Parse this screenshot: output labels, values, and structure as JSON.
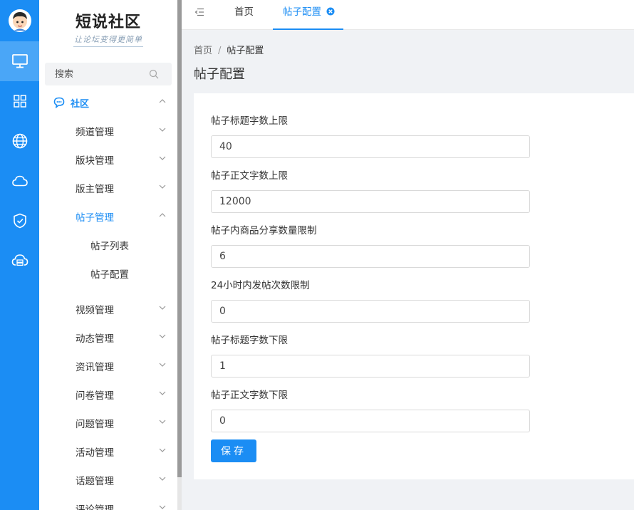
{
  "app": {
    "logo_title": "短说社区",
    "logo_subtitle": "让论坛变得更简单"
  },
  "rail": {
    "items": [
      {
        "icon": "monitor-icon",
        "active": true
      },
      {
        "icon": "grid-icon",
        "active": false
      },
      {
        "icon": "globe-icon",
        "active": false
      },
      {
        "icon": "cloud-icon",
        "active": false
      },
      {
        "icon": "shield-check-icon",
        "active": false
      },
      {
        "icon": "cloud-server-icon",
        "active": false
      }
    ]
  },
  "search": {
    "placeholder": "搜索"
  },
  "nav": {
    "group": {
      "label": "社区",
      "icon": "chat-icon"
    },
    "items": [
      {
        "label": "频道管理"
      },
      {
        "label": "版块管理"
      },
      {
        "label": "版主管理"
      },
      {
        "label": "帖子管理",
        "expanded": true
      },
      {
        "label": "视频管理"
      },
      {
        "label": "动态管理"
      },
      {
        "label": "资讯管理"
      },
      {
        "label": "问卷管理"
      },
      {
        "label": "问题管理"
      },
      {
        "label": "活动管理"
      },
      {
        "label": "话题管理"
      },
      {
        "label": "评论管理"
      }
    ],
    "sub_items": [
      {
        "label": "帖子列表"
      },
      {
        "label": "帖子配置"
      }
    ]
  },
  "tabs": [
    {
      "label": "首页"
    },
    {
      "label": "帖子配置",
      "active": true
    }
  ],
  "breadcrumb": {
    "home": "首页",
    "separator": "/",
    "current": "帖子配置"
  },
  "page_title": "帖子配置",
  "form": {
    "fields": [
      {
        "label": "帖子标题字数上限",
        "value": "40"
      },
      {
        "label": "帖子正文字数上限",
        "value": "12000"
      },
      {
        "label": "帖子内商品分享数量限制",
        "value": "6"
      },
      {
        "label": "24小时内发帖次数限制",
        "value": "0"
      },
      {
        "label": "帖子标题字数下限",
        "value": "1"
      },
      {
        "label": "帖子正文字数下限",
        "value": "0"
      }
    ],
    "save_label": "保存"
  },
  "colors": {
    "primary": "#1b8df4",
    "rail_active": "#4aa6f7"
  }
}
